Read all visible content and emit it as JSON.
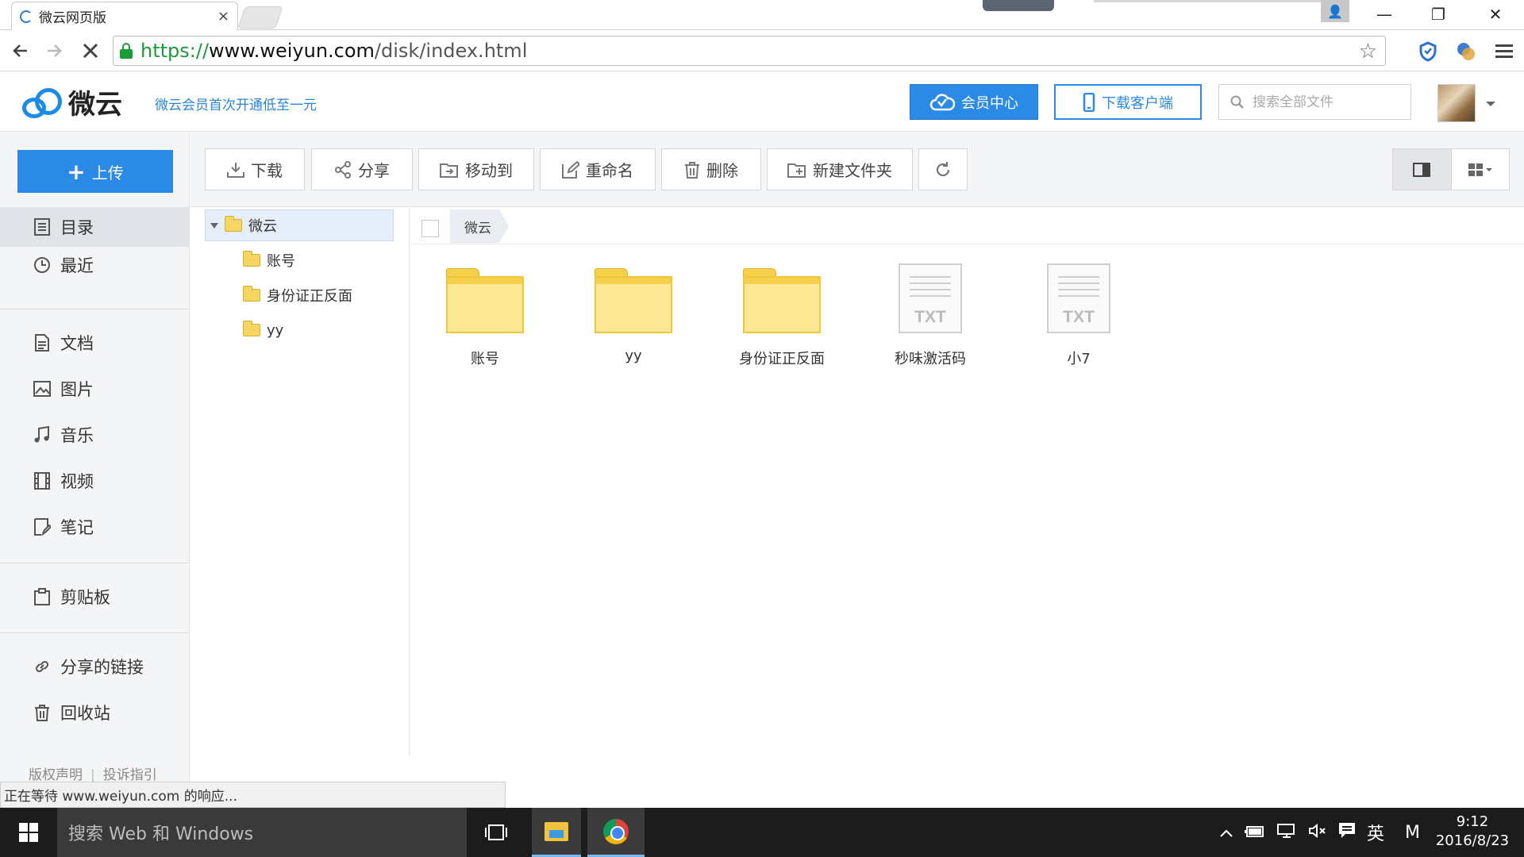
{
  "browser": {
    "tab_title": "微云网页版",
    "tab_close": "×",
    "url_https": "https://",
    "url_host": "www.weiyun.com",
    "url_path": "/disk/index.html",
    "star": "☆",
    "win_minimize": "—",
    "win_restore": "❐",
    "win_close": "✕"
  },
  "header": {
    "logo_text": "微云",
    "promo": "微云会员首次开通低至一元",
    "vip_button": "会员中心",
    "download_button": "下载客户端",
    "search_placeholder": "搜索全部文件"
  },
  "sidebar": {
    "upload_label": "上传",
    "upload_plus": "+",
    "items": [
      {
        "label": "目录",
        "icon": "directory-icon"
      },
      {
        "label": "最近",
        "icon": "clock-icon"
      },
      {
        "label": "文档",
        "icon": "document-icon"
      },
      {
        "label": "图片",
        "icon": "image-icon"
      },
      {
        "label": "音乐",
        "icon": "music-icon"
      },
      {
        "label": "视频",
        "icon": "video-icon"
      },
      {
        "label": "笔记",
        "icon": "note-icon"
      },
      {
        "label": "剪贴板",
        "icon": "clipboard-icon"
      },
      {
        "label": "分享的链接",
        "icon": "link-icon"
      },
      {
        "label": "回收站",
        "icon": "trash-icon"
      }
    ],
    "footer_copyright": "版权声明",
    "footer_divider": "|",
    "footer_complaint": "投诉指引"
  },
  "toolbar": {
    "download": "下载",
    "share": "分享",
    "move": "移动到",
    "rename": "重命名",
    "delete": "删除",
    "new_folder": "新建文件夹"
  },
  "tree": {
    "root": "微云",
    "children": [
      "账号",
      "身份证正反面",
      "yy"
    ]
  },
  "content": {
    "breadcrumb": "微云",
    "files": [
      {
        "name": "账号",
        "type": "folder"
      },
      {
        "name": "yy",
        "type": "folder"
      },
      {
        "name": "身份证正反面",
        "type": "folder"
      },
      {
        "name": "秒味激活码",
        "type": "txt",
        "badge": "TXT"
      },
      {
        "name": "小7",
        "type": "txt",
        "badge": "TXT"
      }
    ]
  },
  "status_text": "正在等待 www.weiyun.com 的响应...",
  "taskbar": {
    "search_placeholder": "搜索 Web 和 Windows",
    "ime_label": "英",
    "ime_mode": "M",
    "time": "9:12",
    "date": "2016/8/23"
  },
  "colors": {
    "accent": "#2b8ae6",
    "folder": "#fde895",
    "taskbar": "#1c1c1c"
  }
}
